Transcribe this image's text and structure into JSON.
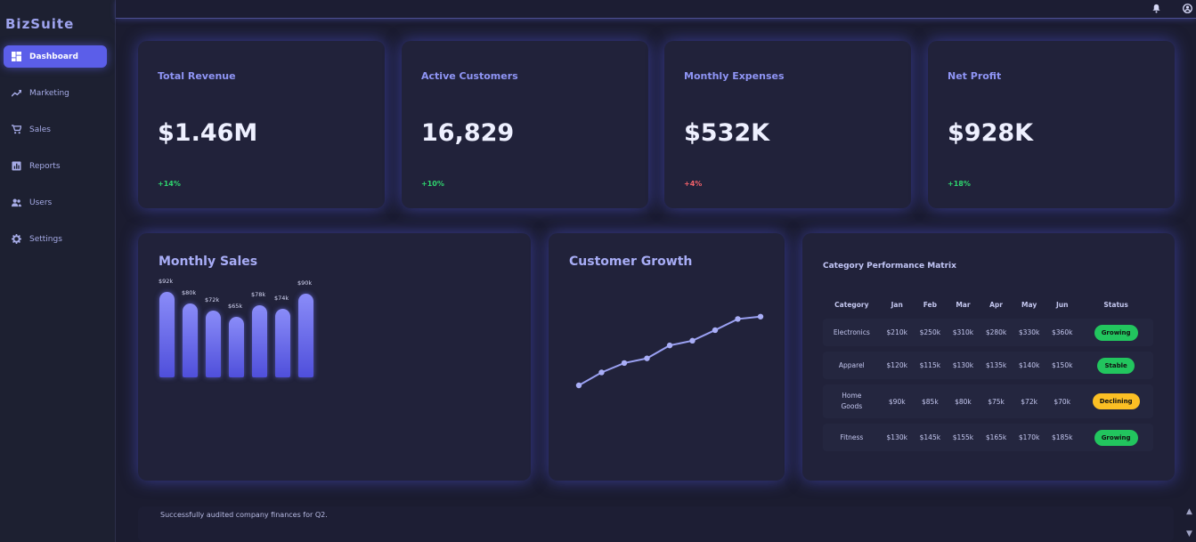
{
  "app": {
    "brand": "BizSuite"
  },
  "sidebar": {
    "items": [
      {
        "label": "Dashboard",
        "icon": "dashboard-icon",
        "active": true
      },
      {
        "label": "Marketing",
        "icon": "trend-icon",
        "active": false
      },
      {
        "label": "Sales",
        "icon": "cart-icon",
        "active": false
      },
      {
        "label": "Reports",
        "icon": "report-icon",
        "active": false
      },
      {
        "label": "Users",
        "icon": "users-icon",
        "active": false
      },
      {
        "label": "Settings",
        "icon": "gear-icon",
        "active": false
      }
    ]
  },
  "header": {
    "icons": [
      "bell-icon",
      "account-icon"
    ]
  },
  "kpis": [
    {
      "title": "Total Revenue",
      "value": "$1.46M",
      "delta": "+14%",
      "trend": "up"
    },
    {
      "title": "Active Customers",
      "value": "16,829",
      "delta": "+10%",
      "trend": "up"
    },
    {
      "title": "Monthly Expenses",
      "value": "$532K",
      "delta": "+4%",
      "trend": "down"
    },
    {
      "title": "Net Profit",
      "value": "$928K",
      "delta": "+18%",
      "trend": "up"
    }
  ],
  "monthly_sales": {
    "title": "Monthly Sales"
  },
  "customer_growth": {
    "title": "Customer Growth"
  },
  "chart_data": [
    {
      "type": "bar",
      "categories": [
        "",
        "",
        "",
        "",
        "",
        "",
        ""
      ],
      "values": [
        92,
        80,
        72,
        65,
        78,
        74,
        90
      ],
      "labels": [
        "$92k",
        "$80k",
        "$72k",
        "$65k",
        "$78k",
        "$74k",
        "$90k"
      ],
      "title": "Monthly Sales",
      "xlabel": "",
      "ylabel": ""
    },
    {
      "type": "line",
      "values": [
        0,
        2.2,
        3.8,
        4.6,
        6.8,
        7.6,
        9.4,
        11.3,
        11.7
      ],
      "title": "Customer Growth",
      "xlabel": "",
      "ylabel": ""
    }
  ],
  "matrix": {
    "title": "Category Performance Matrix",
    "columns": [
      "Category",
      "Jan",
      "Feb",
      "Mar",
      "Apr",
      "May",
      "Jun",
      "Status"
    ],
    "rows": [
      {
        "category": "Electronics",
        "values": [
          "$210k",
          "$250k",
          "$310k",
          "$280k",
          "$330k",
          "$360k"
        ],
        "status": "Growing"
      },
      {
        "category": "Apparel",
        "values": [
          "$120k",
          "$115k",
          "$130k",
          "$135k",
          "$140k",
          "$150k"
        ],
        "status": "Stable"
      },
      {
        "category": "Home Goods",
        "values": [
          "$90k",
          "$85k",
          "$80k",
          "$75k",
          "$72k",
          "$70k"
        ],
        "status": "Declining"
      },
      {
        "category": "Fitness",
        "values": [
          "$130k",
          "$145k",
          "$155k",
          "$165k",
          "$170k",
          "$185k"
        ],
        "status": "Growing"
      }
    ]
  },
  "status_colors": {
    "Growing": "#22c55e",
    "Stable": "#22c55e",
    "Declining": "#fbbf24"
  },
  "activity": {
    "message": "Successfully audited company finances for Q2."
  }
}
